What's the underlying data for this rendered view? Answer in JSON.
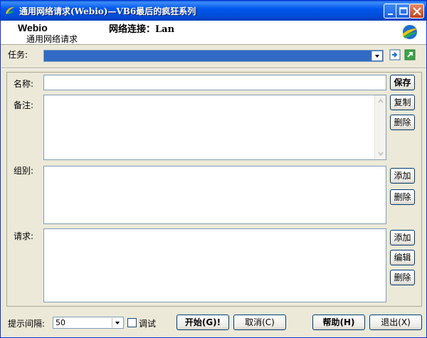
{
  "window": {
    "title": "通用网络请求(Webio)—VB6最后的疯狂系列",
    "title_icon": "app-swirl-icon"
  },
  "header": {
    "brand": "Webio",
    "brand_sub": "通用网络请求",
    "connection": "网络连接：Lan",
    "logo": "globe-logo-icon"
  },
  "task": {
    "label": "任务:",
    "value": ""
  },
  "form": {
    "name_label": "名称:",
    "name_value": "",
    "note_label": "备注:",
    "note_value": "",
    "group_label": "组别:",
    "group_value": "",
    "request_label": "请求:",
    "request_value": ""
  },
  "buttons": {
    "save": "保存",
    "copy": "复制",
    "delete_note": "删除",
    "group_add": "添加",
    "group_delete": "删除",
    "request_add": "添加",
    "request_edit": "编辑",
    "request_delete": "删除",
    "start": "开始(G)!",
    "cancel": "取消(C)",
    "help": "帮助(H)",
    "exit": "退出(X)"
  },
  "footer": {
    "interval_label": "提示间隔:",
    "interval_value": "50",
    "debug_label": "调试",
    "debug_checked": false
  }
}
